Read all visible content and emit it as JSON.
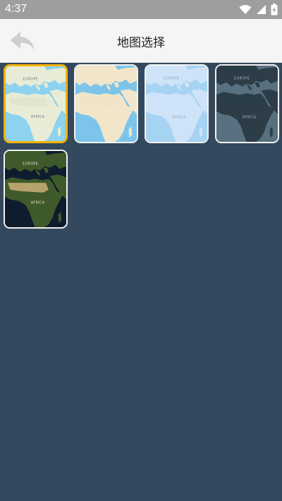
{
  "status_bar": {
    "time": "4:37",
    "icons": [
      "wifi-icon",
      "signal-icon",
      "battery-charging-icon"
    ]
  },
  "header": {
    "title": "地图选择",
    "back_icon": "back-arrow-icon"
  },
  "map_styles": [
    {
      "label_north": "EUROPE",
      "label_south": "AFRICA",
      "selected": true,
      "sea": "#8dd2ef",
      "land": "#e8ecd6",
      "sahara": "#dfe3cd",
      "text": "#6d7a80"
    },
    {
      "label_north": "",
      "label_south": "",
      "selected": false,
      "sea": "#7cc4ea",
      "land": "#f2e6ca",
      "sahara": "#f0e3c5",
      "text": "#8a8a8a"
    },
    {
      "label_north": "EUROPE",
      "label_south": "AFRICA",
      "selected": false,
      "sea": "#a7d3f3",
      "land": "#cfe3f8",
      "sahara": "#cfe3f8",
      "text": "#8aa4bd"
    },
    {
      "label_north": "EUROPE",
      "label_south": "AFRICA",
      "selected": false,
      "sea": "#58707f",
      "land": "#2c3d48",
      "sahara": "#2c3d48",
      "text": "#a7b5bf"
    },
    {
      "label_north": "EUROPE",
      "label_south": "AFRICA",
      "selected": false,
      "sea": "#0f1c2e",
      "land": "#3f5a2a",
      "sahara": "#cdb078",
      "text": "#e9e3d0"
    }
  ]
}
